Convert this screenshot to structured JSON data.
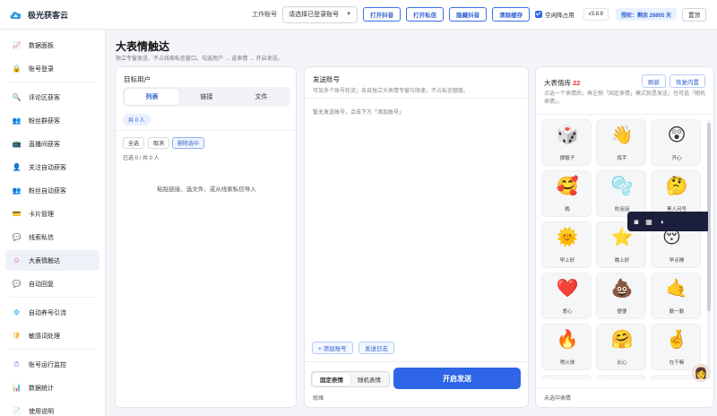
{
  "app": {
    "name": "极光获客云"
  },
  "topbar": {
    "account_label": "工作账号",
    "account_select": "请选择已登录账号",
    "buttons": [
      "打开抖音",
      "打开私信",
      "隐藏抖音",
      "清除缓存"
    ],
    "checkbox_label": "空闲降占用",
    "version": "v3.8.8",
    "auth_text": "授权：剩余 26805 天",
    "reset_label": "置顶"
  },
  "sidebar": {
    "items": [
      {
        "label": "数据面板",
        "icon": "chart-icon"
      },
      {
        "label": "账号登录",
        "icon": "lock-icon"
      },
      {
        "label": "评论区获客",
        "icon": "search-icon"
      },
      {
        "label": "粉丝群获客",
        "icon": "group-icon"
      },
      {
        "label": "直播间获客",
        "icon": "live-icon"
      },
      {
        "label": "关注自动获客",
        "icon": "follow-icon"
      },
      {
        "label": "粉丝自动获客",
        "icon": "fans-icon"
      },
      {
        "label": "卡片管理",
        "icon": "card-icon"
      },
      {
        "label": "线索私信",
        "icon": "message-icon"
      },
      {
        "label": "大表情触达",
        "icon": "smile-icon"
      },
      {
        "label": "自动回复",
        "icon": "reply-icon"
      },
      {
        "label": "自动养号引流",
        "icon": "flow-icon"
      },
      {
        "label": "敏感词处理",
        "icon": "shield-icon"
      },
      {
        "label": "账号运行监控",
        "icon": "monitor-icon"
      },
      {
        "label": "数据统计",
        "icon": "stats-icon"
      },
      {
        "label": "使用说明",
        "icon": "doc-icon"
      }
    ]
  },
  "page": {
    "title": "大表情触达",
    "subtitle": "独立专窗发送、不占线索私信窗口。勾选用户 → 选表情 → 开启发送。"
  },
  "targets": {
    "title": "目标用户",
    "tabs": [
      "列表",
      "链接",
      "文件"
    ],
    "count": "共 0 人",
    "select_all": "全选",
    "cancel": "取消",
    "delete_selected": "删除选中",
    "selected_info": "已选 0 / 共 0 人",
    "empty_tip": "粘贴链接、选文件、或从线索私信导入"
  },
  "sender": {
    "title": "发送账号",
    "subtitle": "可加多个账号轮流；各自独立大表情专窗与限速，不占私信额度。",
    "empty": "暂无发送账号，点击下方「添加账号」",
    "add_button": "+ 添加账号",
    "log_button": "发送日志",
    "modes": [
      "固定表情",
      "随机表情"
    ],
    "start_button": "开启发送",
    "status": "就绪"
  },
  "library": {
    "title": "大表情库",
    "count": "22",
    "refresh": "刷新",
    "restore": "恢复内置",
    "subtitle": "点选一个表情后，再左侧「固定表情」模式就是发送；也可选「随机表情」。",
    "items": [
      {
        "label": "掷骰子",
        "emoji": "🎲"
      },
      {
        "label": "挥手",
        "emoji": "👋"
      },
      {
        "label": "开心",
        "emoji": "😲"
      },
      {
        "label": "晚",
        "emoji": "🥰"
      },
      {
        "label": "吹泡泡",
        "emoji": "🫧"
      },
      {
        "label": "黑人问号",
        "emoji": "🤔"
      },
      {
        "label": "早上好",
        "emoji": "🌞"
      },
      {
        "label": "晚上好",
        "emoji": "⭐"
      },
      {
        "label": "早点睡",
        "emoji": "😴"
      },
      {
        "label": "爱心",
        "emoji": "❤️"
      },
      {
        "label": "便便",
        "emoji": "💩"
      },
      {
        "label": "勤一勤",
        "emoji": "🤙"
      },
      {
        "label": "喷火烧",
        "emoji": "🔥"
      },
      {
        "label": "比心",
        "emoji": "🤗"
      },
      {
        "label": "在干嘛",
        "emoji": "🤞"
      },
      {
        "label": "",
        "emoji": "😊"
      },
      {
        "label": "",
        "emoji": "😁"
      },
      {
        "label": "",
        "emoji": "😄"
      }
    ],
    "status": "未选中表情"
  }
}
